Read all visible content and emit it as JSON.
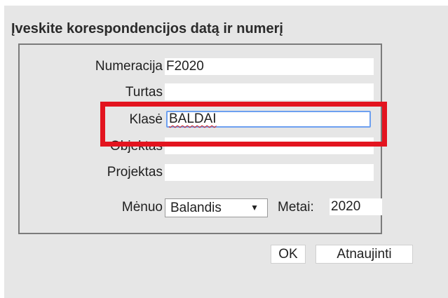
{
  "dialog": {
    "title": "Įveskite korespondencijos datą ir numerį"
  },
  "form": {
    "numeracija": {
      "label": "Numeracija",
      "value": "F2020"
    },
    "turtas": {
      "label": "Turtas",
      "value": ""
    },
    "klase": {
      "label": "Klasė",
      "value": "BALDAI"
    },
    "objektas": {
      "label": "Objektas",
      "value": ""
    },
    "projektas": {
      "label": "Projektas",
      "value": ""
    },
    "menuo": {
      "label": "Mėnuo",
      "selected": "Balandis"
    },
    "metai": {
      "label": "Metai:",
      "value": "2020"
    }
  },
  "buttons": {
    "ok_label": "OK",
    "refresh_label": "Atnaujinti"
  },
  "colors": {
    "highlight": "#e3141f",
    "focus_border": "#6da0f0",
    "panel_background": "#e6e6e6"
  },
  "icons": {
    "dropdown": "chevron-down-icon"
  }
}
